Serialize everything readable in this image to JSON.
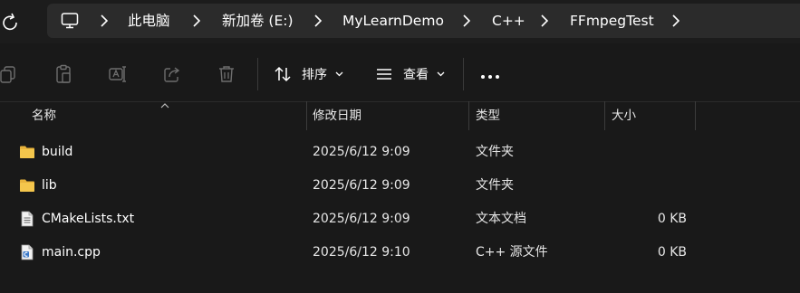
{
  "colors": {
    "background": "#191919",
    "address_bar": "#2b2b2b",
    "folder": "#f4c64c",
    "text": "#ffffff"
  },
  "navigation": {
    "refresh_icon": "refresh-icon",
    "pc_icon": "computer-icon",
    "breadcrumbs": [
      "此电脑",
      "新加卷 (E:)",
      "MyLearnDemo",
      "C++",
      "FFmpegTest"
    ]
  },
  "toolbar": {
    "icons": [
      "copy-icon",
      "paste-icon",
      "rename-icon",
      "share-icon",
      "delete-icon"
    ],
    "sort_label": "排序",
    "view_label": "查看",
    "more_icon": "more-icon"
  },
  "columns": {
    "name": "名称",
    "modified": "修改日期",
    "type": "类型",
    "size": "大小"
  },
  "files": [
    {
      "name": "build",
      "modified": "2025/6/12 9:09",
      "type": "文件夹",
      "size": "",
      "icon": "folder-icon"
    },
    {
      "name": "lib",
      "modified": "2025/6/12 9:09",
      "type": "文件夹",
      "size": "",
      "icon": "folder-icon"
    },
    {
      "name": "CMakeLists.txt",
      "modified": "2025/6/12 9:09",
      "type": "文本文档",
      "size": "0 KB",
      "icon": "text-file-icon"
    },
    {
      "name": "main.cpp",
      "modified": "2025/6/12 9:10",
      "type": "C++ 源文件",
      "size": "0 KB",
      "icon": "cpp-file-icon"
    }
  ]
}
